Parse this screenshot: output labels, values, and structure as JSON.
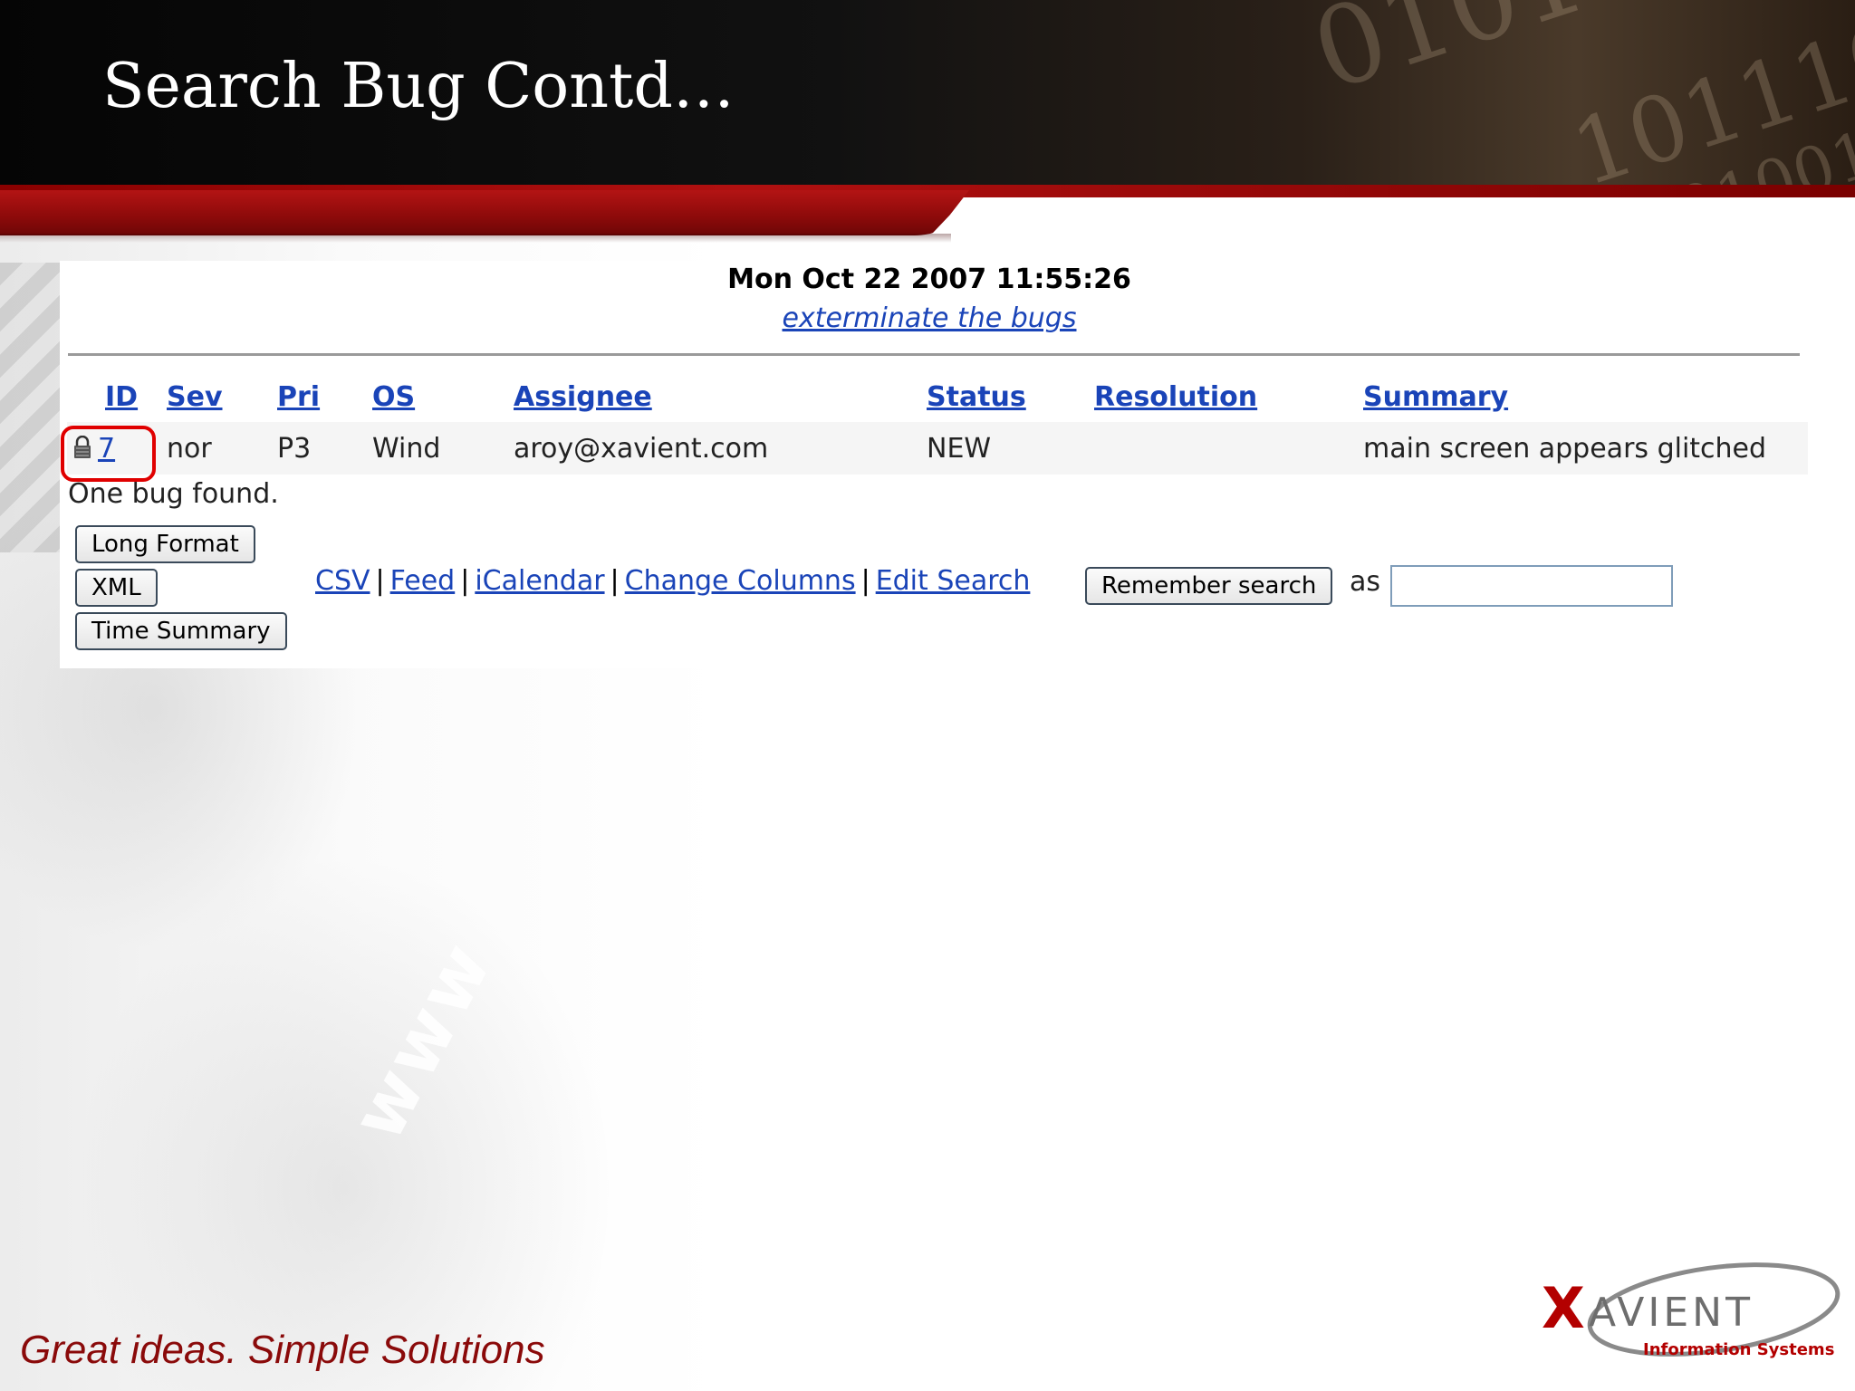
{
  "slide": {
    "title": "Search Bug Contd…",
    "tagline": "Great ideas.  Simple Solutions",
    "logo": {
      "name": "XAVIENT",
      "subtitle": "Information Systems"
    }
  },
  "bugzilla": {
    "date": "Mon Oct 22 2007 11:55:26",
    "subtitle": "exterminate the bugs",
    "columns": [
      "ID",
      "Sev",
      "Pri",
      "OS",
      "Assignee",
      "Status",
      "Resolution",
      "Summary"
    ],
    "rows": [
      {
        "id": "7",
        "sev": "nor",
        "pri": "P3",
        "os": "Wind",
        "assignee": "aroy@xavient.com",
        "status": "NEW",
        "resolution": "",
        "summary": "main screen appears glitched"
      }
    ],
    "result_text": "One bug found.",
    "buttons": {
      "long_format": "Long Format",
      "xml": "XML",
      "time_summary": "Time Summary",
      "remember_search": "Remember search"
    },
    "links": {
      "csv": "CSV",
      "feed": "Feed",
      "icalendar": "iCalendar",
      "change_columns": "Change Columns",
      "edit_search": "Edit Search"
    },
    "separator": "|",
    "as_label": "as",
    "remember_name_value": ""
  },
  "colors": {
    "link": "#1a44b8",
    "highlight": "#e00000",
    "brand_red": "#8a0a0a",
    "header_band": "#0a0a0a"
  }
}
